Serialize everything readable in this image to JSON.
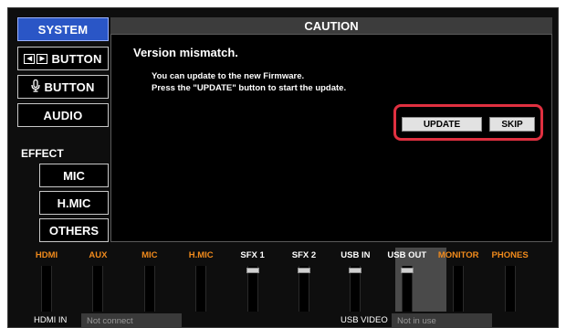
{
  "sidebar": {
    "system": "SYSTEM",
    "button_lr": "BUTTON",
    "button_mic": "BUTTON",
    "audio": "AUDIO",
    "effect": "EFFECT",
    "mic": "MIC",
    "hmic": "H.MIC",
    "others": "OTHERS"
  },
  "dialog": {
    "header": "CAUTION",
    "title": "Version mismatch.",
    "line1": "You can update to the new Firmware.",
    "line2": "Press the \"UPDATE\" button to start the update.",
    "update": "UPDATE",
    "skip": "SKIP"
  },
  "mixer": {
    "channels": [
      {
        "label": "HDMI",
        "color": "#f08a1c",
        "level": 0
      },
      {
        "label": "AUX",
        "color": "#f08a1c",
        "level": 0
      },
      {
        "label": "MIC",
        "color": "#f08a1c",
        "level": 0
      },
      {
        "label": "H.MIC",
        "color": "#f08a1c",
        "level": 0
      },
      {
        "label": "SFX 1",
        "color": "#ffffff",
        "level": 1
      },
      {
        "label": "SFX 2",
        "color": "#ffffff",
        "level": 1
      },
      {
        "label": "USB IN",
        "color": "#ffffff",
        "level": 1
      },
      {
        "label": "USB OUT",
        "color": "#ffffff",
        "level": 1
      },
      {
        "label": "MONITOR",
        "color": "#f08a1c",
        "level": 0
      },
      {
        "label": "PHONES",
        "color": "#f08a1c",
        "level": 0
      }
    ]
  },
  "status": {
    "hdmi_in_label": "HDMI IN",
    "hdmi_in_value": "Not connect",
    "usb_video_label": "USB VIDEO",
    "usb_video_value": "Not in use"
  }
}
